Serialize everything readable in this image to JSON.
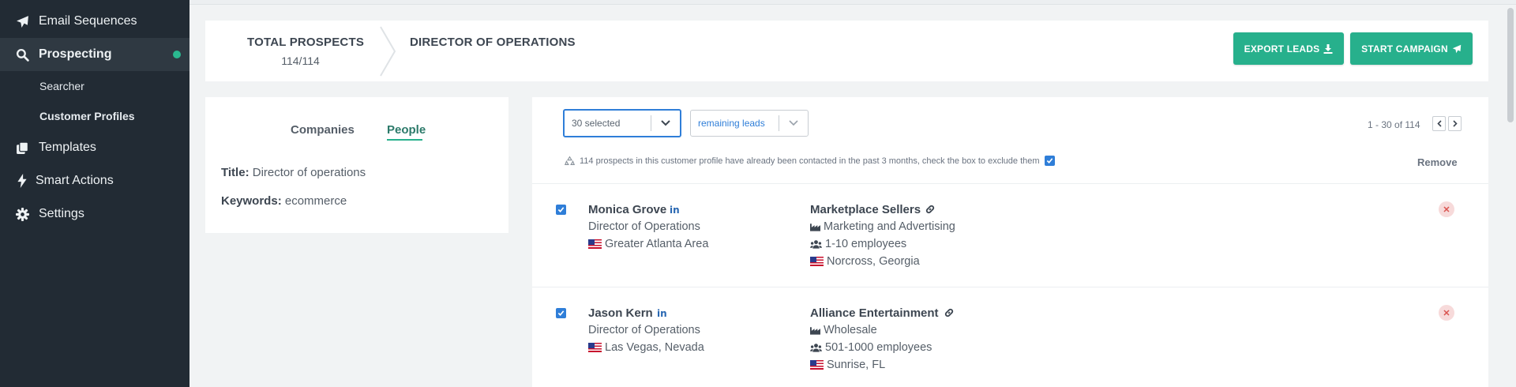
{
  "sidebar": {
    "items": [
      {
        "label": "Email Sequences",
        "icon": "paper-plane-icon"
      },
      {
        "label": "Prospecting",
        "icon": "search-icon",
        "active": true
      },
      {
        "label": "Templates",
        "icon": "copy-icon"
      },
      {
        "label": "Smart Actions",
        "icon": "bolt-icon"
      },
      {
        "label": "Settings",
        "icon": "gear-icon"
      }
    ],
    "subitems": [
      {
        "label": "Searcher"
      },
      {
        "label": "Customer Profiles",
        "active": true
      }
    ]
  },
  "header": {
    "total_label": "TOTAL PROSPECTS",
    "total_count": "114/114",
    "profile_title": "DIRECTOR OF OPERATIONS",
    "export_label": "EXPORT LEADS",
    "campaign_label": "START CAMPAIGN"
  },
  "filters": {
    "tabs": [
      {
        "label": "Companies"
      },
      {
        "label": "People",
        "active": true
      }
    ],
    "title_key": "Title:",
    "title_value": "Director of operations",
    "keywords_key": "Keywords:",
    "keywords_value": "ecommerce"
  },
  "list": {
    "selection": "30 selected",
    "filter": "remaining leads",
    "pagination": "1 - 30 of 114",
    "notice": "114 prospects in this customer profile have already been contacted in the past 3 months, check the box to exclude them",
    "remove_label": "Remove",
    "rows": [
      {
        "name": "Monica Grove",
        "title": "Director of Operations",
        "location": "Greater Atlanta Area",
        "company": "Marketplace Sellers",
        "industry": "Marketing and Advertising",
        "size": "1-10 employees",
        "company_location": "Norcross, Georgia"
      },
      {
        "name": "Jason Kern",
        "title": "Director of Operations",
        "location": "Las Vegas, Nevada",
        "company": "Alliance Entertainment",
        "industry": "Wholesale",
        "size": "501-1000 employees",
        "company_location": "Sunrise, FL"
      }
    ]
  },
  "colors": {
    "sidebar_bg": "#222b34",
    "accent": "#27b08c",
    "link_blue": "#2f7ed8"
  }
}
